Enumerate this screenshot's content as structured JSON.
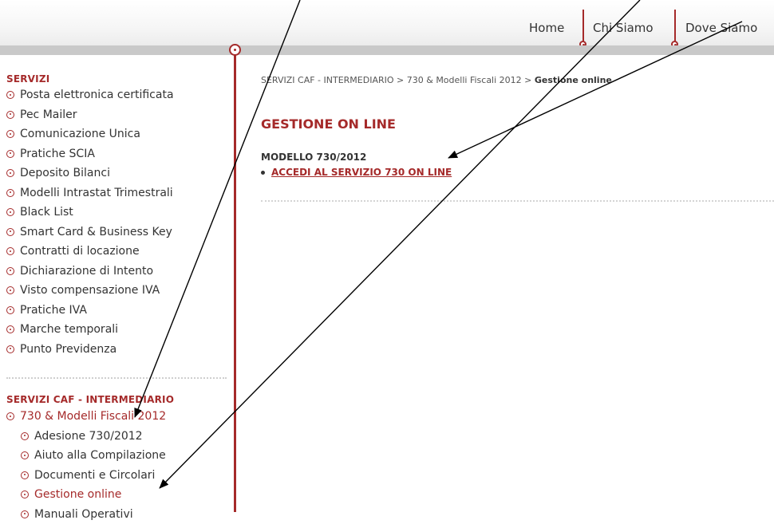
{
  "nav": {
    "home": "Home",
    "chi_siamo": "Chi Siamo",
    "dove_siamo": "Dove Siamo"
  },
  "sidebar": {
    "servizi_heading": "SERVIZI",
    "servizi_items": [
      "Posta elettronica certificata",
      "Pec Mailer",
      "Comunicazione Unica",
      "Pratiche SCIA",
      "Deposito Bilanci",
      "Modelli Intrastat Trimestrali",
      "Black List",
      "Smart Card & Business Key",
      "Contratti di locazione",
      "Dichiarazione di Intento",
      "Visto compensazione IVA",
      "Pratiche IVA",
      "Marche temporali",
      "Punto Previdenza"
    ],
    "caf_heading": "SERVIZI CAF - INTERMEDIARIO",
    "caf_items": [
      "730 & Modelli Fiscali 2012",
      "Adesione 730/2012",
      "Aiuto alla Compilazione",
      "Documenti e Circolari",
      "Gestione online",
      "Manuali Operativi"
    ]
  },
  "breadcrumb": {
    "part1": "SERVIZI CAF - INTERMEDIARIO",
    "sep": ">",
    "part2": "730 & Modelli Fiscali 2012",
    "current": "Gestione online"
  },
  "content": {
    "title": "GESTIONE ON LINE",
    "model_heading": "MODELLO 730/2012",
    "access_link": "ACCEDI AL SERVIZIO 730 ON LINE"
  },
  "colors": {
    "accent": "#a52a2a",
    "text": "#333333",
    "band": "#c9c9c9"
  }
}
